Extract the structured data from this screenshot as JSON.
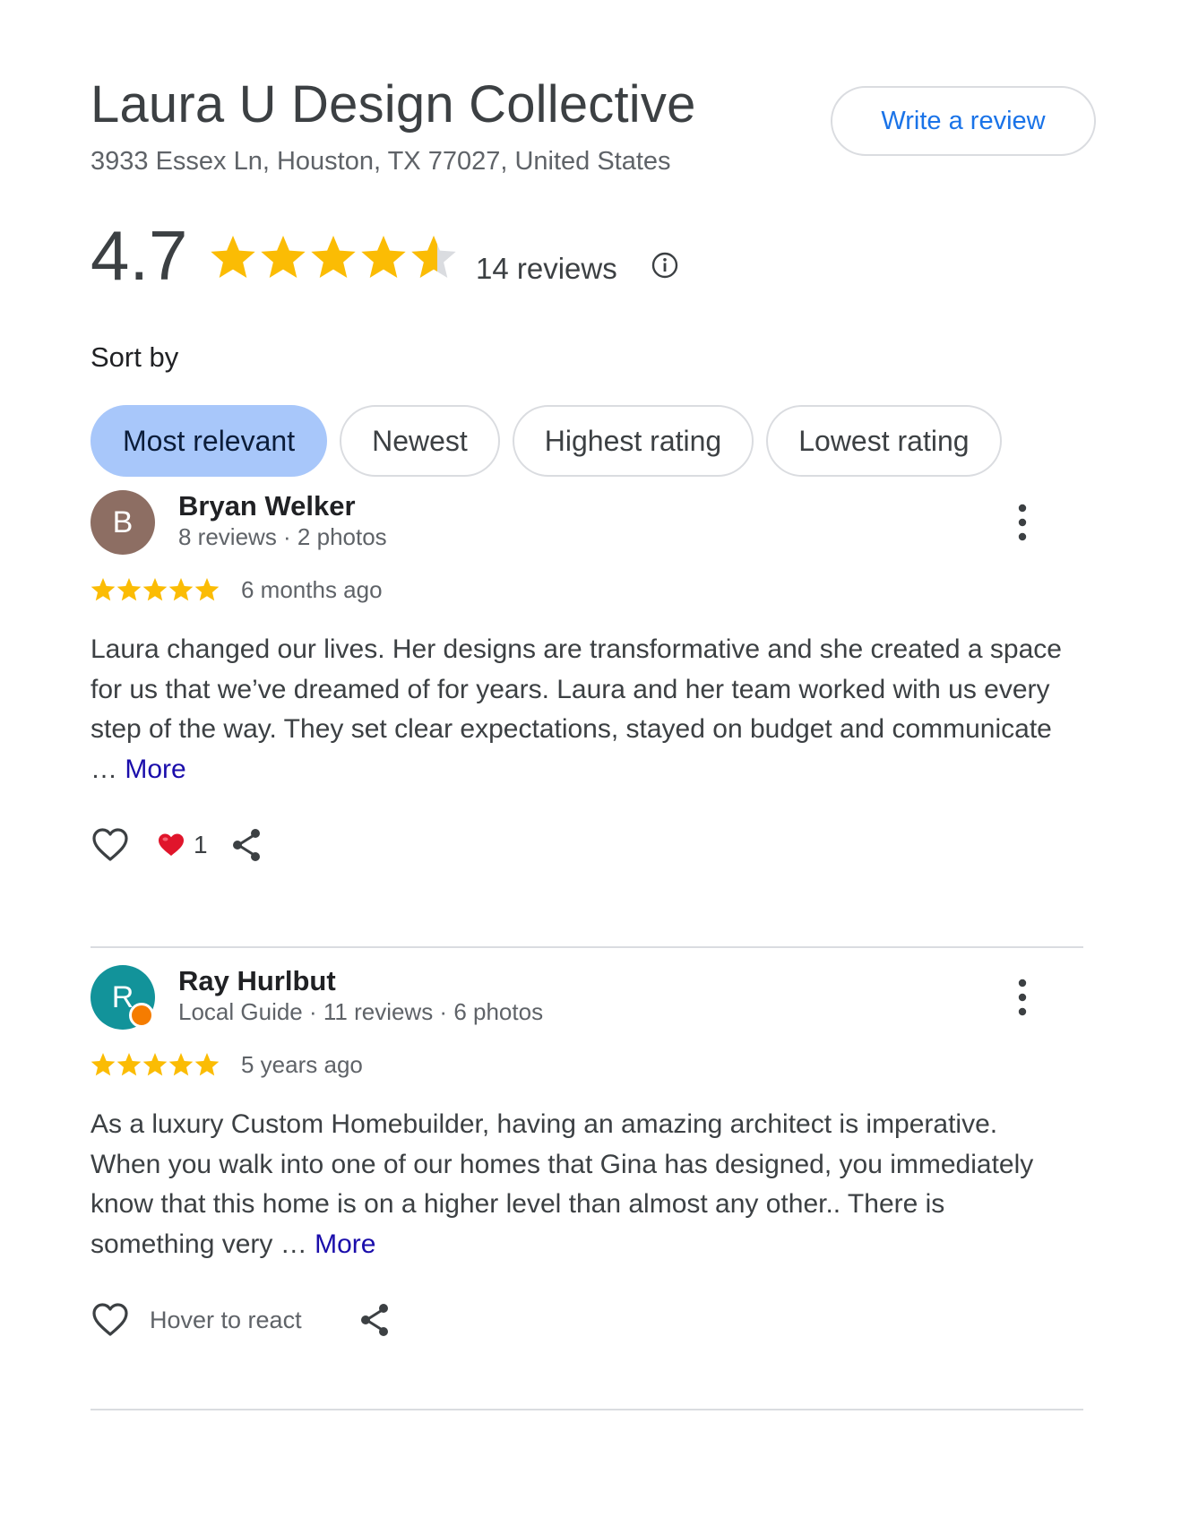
{
  "place": {
    "title": "Laura U Design Collective",
    "address": "3933 Essex Ln, Houston, TX 77027, United States",
    "write_review_label": "Write a review"
  },
  "rating": {
    "value": "4.7",
    "stars_filled": 4.7,
    "review_count": "14 reviews",
    "info_icon": "info-icon"
  },
  "sort": {
    "label": "Sort by",
    "options": [
      "Most relevant",
      "Newest",
      "Highest rating",
      "Lowest rating"
    ],
    "selected": "Most relevant"
  },
  "reviews": [
    {
      "avatar_letter": "B",
      "avatar_color": "#8d6e63",
      "name": "Bryan Welker",
      "meta": "8 reviews · 2 photos",
      "stars": 5,
      "time": "6 months ago",
      "text": "Laura changed our lives. Her designs are transformative and she created a space for us that we’ve dreamed of for years. Laura and her team worked with us every step of the way. They set clear expectations, stayed on budget and communicate … ",
      "more_label": "More",
      "reaction_count": "1"
    },
    {
      "avatar_letter": "R",
      "avatar_color": "#12939a",
      "local_guide_badge": true,
      "name": "Ray Hurlbut",
      "meta": "Local Guide · 11 reviews · 6 photos",
      "stars": 5,
      "time": "5 years ago",
      "text": "As a luxury Custom Homebuilder, having an amazing architect is imperative. When you walk into one of our homes that Gina has designed, you immediately know that this home is on a higher level than almost any other.. There is something very … ",
      "more_label": "More",
      "hover_label": "Hover to react"
    }
  ],
  "colors": {
    "star": "#fbbc04",
    "star_empty": "#dadce0",
    "link": "#1a73e8",
    "more_link": "#1a0dab",
    "chip_selected": "#a8c7fa"
  }
}
